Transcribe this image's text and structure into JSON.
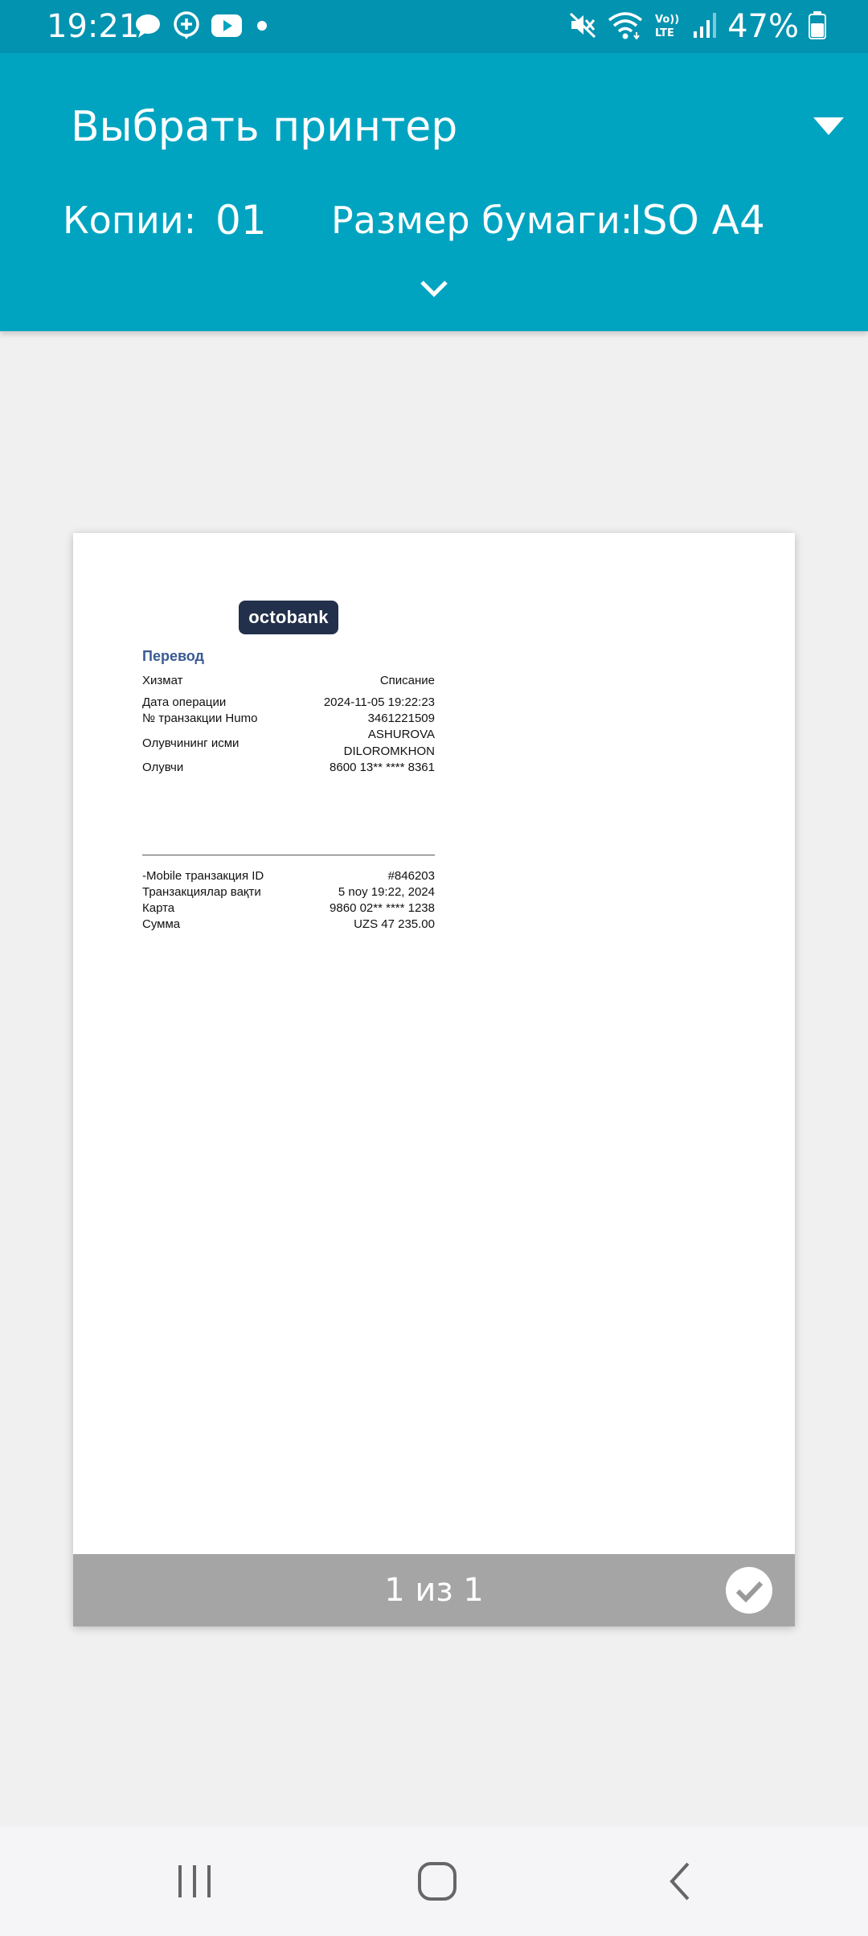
{
  "status_bar": {
    "time": "19:21",
    "notification_icons": [
      "chat-bubble-icon",
      "plus-chat-icon",
      "youtube-icon",
      "dot-icon"
    ],
    "system_icons": [
      "mute-icon",
      "wifi-icon",
      "volte-icon",
      "signal-icon"
    ],
    "battery_percent": "47%"
  },
  "header": {
    "printer_label": "Выбрать принтер",
    "copies_label": "Копии:",
    "copies_value": "01",
    "paper_label": "Размер бумаги:",
    "paper_value": "ISO A4"
  },
  "receipt": {
    "logo_text": "octobank",
    "title": "Перевод",
    "rows": [
      {
        "key": "Хизмат",
        "value": "Списание"
      },
      {
        "key": "Дата операции",
        "value": "2024-11-05 19:22:23"
      },
      {
        "key": "№ транзакции Humo",
        "value": "3461221509"
      },
      {
        "key": "Олувчининг исми",
        "value": "ASHUROVA",
        "value2": "DILOROMKHON"
      },
      {
        "key": "Олувчи",
        "value": "8600 13** **** 8361"
      },
      {
        "key": "-Mobile транзакция ID",
        "value": "#846203"
      },
      {
        "key": "Транзакциялар вақти",
        "value": "5 noy 19:22, 2024"
      },
      {
        "key": "Карта",
        "value": "9860 02** **** 1238"
      },
      {
        "key": "Сумма",
        "value": "UZS 47 235.00"
      }
    ]
  },
  "preview": {
    "page_counter": "1 из 1"
  },
  "colors": {
    "header": "#00a4c1",
    "status_bar": "#0293b0",
    "logo_bg": "#23304b",
    "title": "#3a5a92"
  }
}
